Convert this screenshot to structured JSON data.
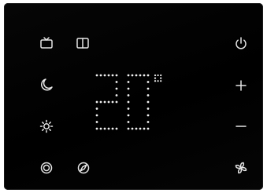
{
  "display": {
    "temperature": "20",
    "unit": "°"
  },
  "icons": {
    "tv": "tv-icon",
    "book": "book-icon",
    "power": "power-icon",
    "moon": "moon-icon",
    "plus": "plus-icon",
    "sun": "sun-icon",
    "minus": "minus-icon",
    "target": "target-icon",
    "compass": "compass-icon",
    "fan": "fan-icon"
  },
  "colors": {
    "panel": "#000000",
    "foreground": "#e6e6e6"
  }
}
